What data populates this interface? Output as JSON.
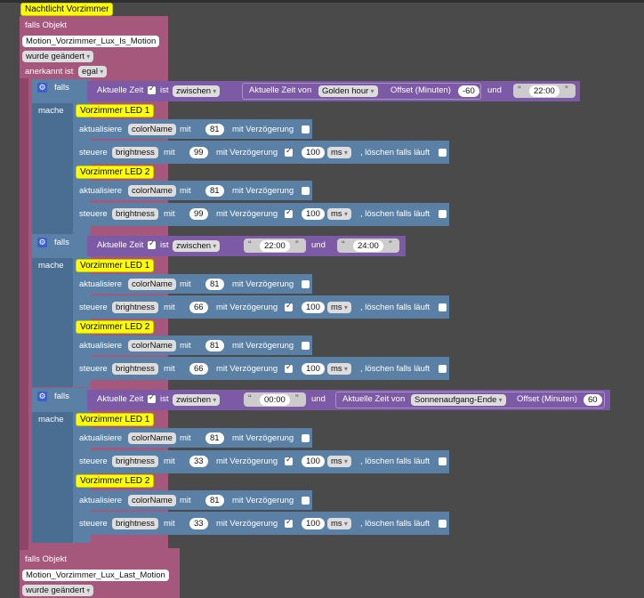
{
  "event_block": {
    "title": "Nachtlicht Vorzimmer",
    "trigger1": {
      "label": "falls Objekt",
      "object": "Motion_Vorzimmer_Lux_Is_Motion",
      "change": "wurde geändert",
      "ack_label": "anerkannt ist",
      "ack_value": "egal"
    },
    "trigger2": {
      "label": "falls Objekt",
      "object": "Motion_Vorzimmer_Lux_Last_Motion",
      "change": "wurde geändert"
    }
  },
  "common": {
    "if_label": "falls",
    "do_label": "mache",
    "current_time": "Aktuelle Zeit",
    "is": "ist",
    "between": "zwischen",
    "and": "und",
    "current_time_of": "Aktuelle Zeit von",
    "offset_label": "Offset (Minuten)",
    "update": "aktualisiere",
    "colorname": "colorName",
    "with": "mit",
    "with_delay": "mit Verzögerung",
    "control": "steuere",
    "brightness": "brightness",
    "unit_ms": "ms",
    "clear_running": ", löschen falls läuft",
    "led1": "Vorzimmer LED 1",
    "led2": "Vorzimmer LED 2",
    "color_value": "81",
    "delay_value": "100"
  },
  "branches": [
    {
      "condition": {
        "from_type": "astro",
        "astro": "Golden hour",
        "offset": "-60",
        "to": "22:00"
      },
      "brightness": "99"
    },
    {
      "condition": {
        "from_type": "time",
        "from": "22:00",
        "to": "24:00"
      },
      "brightness": "66"
    },
    {
      "condition": {
        "from_type": "time",
        "from": "00:00",
        "to_astro": "Sonnenaufgang-Ende",
        "to_offset": "60"
      },
      "brightness": "33"
    }
  ]
}
